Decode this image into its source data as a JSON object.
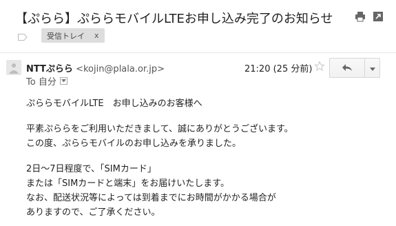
{
  "subject": "【ぷらら】ぷららモバイルLTEお申し込み完了のお知らせ",
  "label": {
    "name": "受信トレイ",
    "remove": "x"
  },
  "sender": {
    "name": "NTTぷらら",
    "email": "<kojin@plala.or.jp>"
  },
  "date": "21:20 (25 分前)",
  "recipient": "To 自分",
  "body": {
    "p1": [
      "ぷららモバイルLTE　お申し込みのお客様へ"
    ],
    "p2": [
      "平素ぷららをご利用いただきまして、誠にありがとうございます。",
      "この度、ぷららモバイルのお申し込みを承りました。"
    ],
    "p3": [
      "2日〜7日程度で、「SIMカード」",
      "または「SIMカードと端末」をお届けいたします。",
      "なお、配送状況等によっては到着までにお時間がかかる場合が",
      "ありますので、ご了承ください。"
    ]
  },
  "icons": {
    "print": "print-icon",
    "popout": "open-in-new-window-icon",
    "label": "label-tag-icon",
    "avatar": "default-avatar-icon",
    "star": "star-icon",
    "reply": "reply-icon",
    "more": "chevron-down-icon",
    "toggle": "details-toggle-icon"
  },
  "colors": {
    "label_chip": "#dddddd",
    "icon": "#666666",
    "star": "#cccccc",
    "divider": "#e5e5e5"
  }
}
